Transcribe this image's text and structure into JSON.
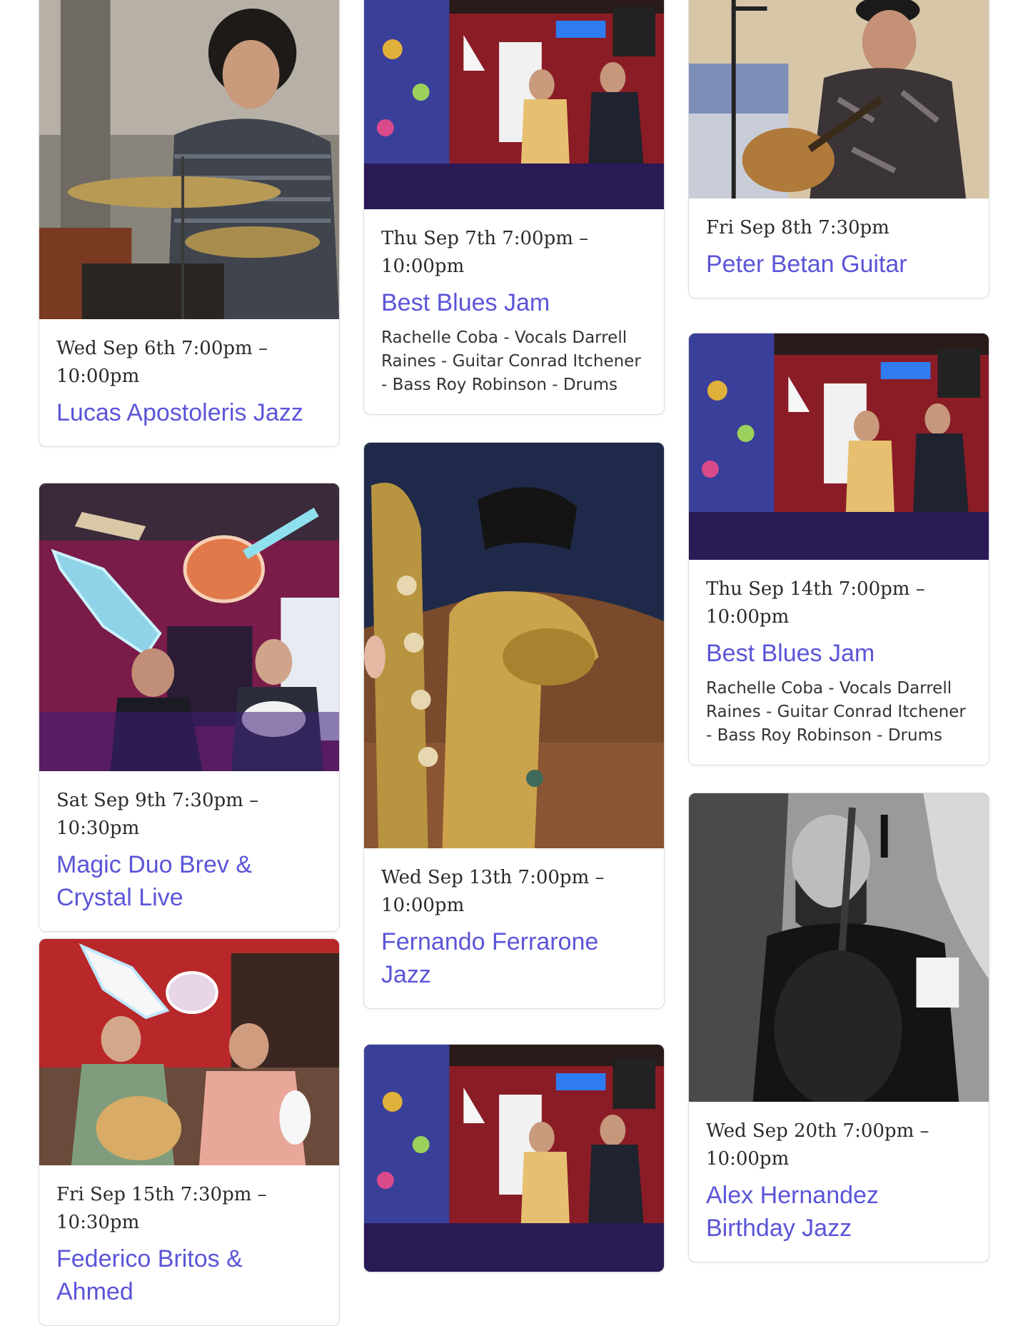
{
  "events": {
    "lucas": {
      "date": "Wed Sep 6th 7:00pm – 10:00pm",
      "title": "Lucas Apostoleris Jazz",
      "image": "drummer-photo"
    },
    "blues_jam_1": {
      "date": "Thu Sep 7th 7:00pm – 10:00pm",
      "title": "Best Blues Jam",
      "description": "Rachelle Coba - Vocals Darrell Raines - Guitar Conrad Itchener - Bass Roy Robinson - Drums",
      "image": "blues-band-stage-photo"
    },
    "peter": {
      "date": "Fri Sep 8th 7:30pm",
      "title": "Peter Betan Guitar",
      "image": "guitarist-photo"
    },
    "magic_duo": {
      "date": "Sat Sep 9th 7:30pm – 10:30pm",
      "title": "Magic Duo Brev & Crystal Live",
      "image": "guitar-duo-neon-photo"
    },
    "fernando": {
      "date": "Wed Sep 13th 7:00pm – 10:00pm",
      "title": "Fernando Ferrarone Jazz",
      "image": "saxophone-photo"
    },
    "blues_jam_2": {
      "date": "Thu Sep 14th 7:00pm – 10:00pm",
      "title": "Best Blues Jam",
      "description": "Rachelle Coba - Vocals Darrell Raines - Guitar Conrad Itchener - Bass Roy Robinson - Drums",
      "image": "blues-band-stage-photo"
    },
    "federico": {
      "date": "Fri Sep 15th 7:30pm – 10:30pm",
      "title": "Federico Britos & Ahmed",
      "image": "guitar-violin-duo-photo"
    },
    "blues_jam_3": {
      "image": "blues-band-stage-photo"
    },
    "alex": {
      "date": "Wed Sep 20th 7:00pm – 10:00pm",
      "title": "Alex Hernandez Birthday Jazz",
      "image": "bassist-bw-photo"
    }
  },
  "colors": {
    "link": "#5b55d8",
    "date_text": "#2a2a2a",
    "card_border": "#dcdcdc"
  }
}
